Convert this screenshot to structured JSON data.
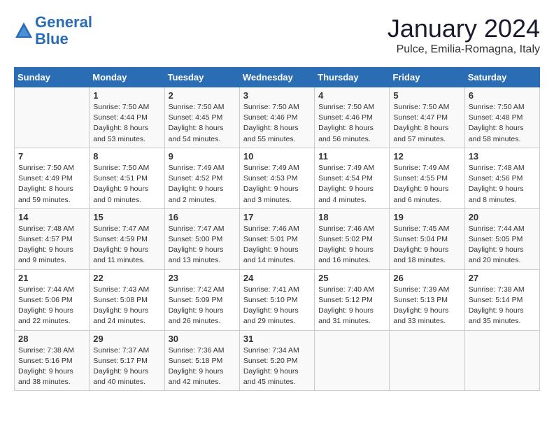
{
  "logo": {
    "line1": "General",
    "line2": "Blue"
  },
  "title": "January 2024",
  "location": "Pulce, Emilia-Romagna, Italy",
  "days_of_week": [
    "Sunday",
    "Monday",
    "Tuesday",
    "Wednesday",
    "Thursday",
    "Friday",
    "Saturday"
  ],
  "weeks": [
    [
      {
        "day": "",
        "info": ""
      },
      {
        "day": "1",
        "info": "Sunrise: 7:50 AM\nSunset: 4:44 PM\nDaylight: 8 hours\nand 53 minutes."
      },
      {
        "day": "2",
        "info": "Sunrise: 7:50 AM\nSunset: 4:45 PM\nDaylight: 8 hours\nand 54 minutes."
      },
      {
        "day": "3",
        "info": "Sunrise: 7:50 AM\nSunset: 4:46 PM\nDaylight: 8 hours\nand 55 minutes."
      },
      {
        "day": "4",
        "info": "Sunrise: 7:50 AM\nSunset: 4:46 PM\nDaylight: 8 hours\nand 56 minutes."
      },
      {
        "day": "5",
        "info": "Sunrise: 7:50 AM\nSunset: 4:47 PM\nDaylight: 8 hours\nand 57 minutes."
      },
      {
        "day": "6",
        "info": "Sunrise: 7:50 AM\nSunset: 4:48 PM\nDaylight: 8 hours\nand 58 minutes."
      }
    ],
    [
      {
        "day": "7",
        "info": "Sunrise: 7:50 AM\nSunset: 4:49 PM\nDaylight: 8 hours\nand 59 minutes."
      },
      {
        "day": "8",
        "info": "Sunrise: 7:50 AM\nSunset: 4:51 PM\nDaylight: 9 hours\nand 0 minutes."
      },
      {
        "day": "9",
        "info": "Sunrise: 7:49 AM\nSunset: 4:52 PM\nDaylight: 9 hours\nand 2 minutes."
      },
      {
        "day": "10",
        "info": "Sunrise: 7:49 AM\nSunset: 4:53 PM\nDaylight: 9 hours\nand 3 minutes."
      },
      {
        "day": "11",
        "info": "Sunrise: 7:49 AM\nSunset: 4:54 PM\nDaylight: 9 hours\nand 4 minutes."
      },
      {
        "day": "12",
        "info": "Sunrise: 7:49 AM\nSunset: 4:55 PM\nDaylight: 9 hours\nand 6 minutes."
      },
      {
        "day": "13",
        "info": "Sunrise: 7:48 AM\nSunset: 4:56 PM\nDaylight: 9 hours\nand 8 minutes."
      }
    ],
    [
      {
        "day": "14",
        "info": "Sunrise: 7:48 AM\nSunset: 4:57 PM\nDaylight: 9 hours\nand 9 minutes."
      },
      {
        "day": "15",
        "info": "Sunrise: 7:47 AM\nSunset: 4:59 PM\nDaylight: 9 hours\nand 11 minutes."
      },
      {
        "day": "16",
        "info": "Sunrise: 7:47 AM\nSunset: 5:00 PM\nDaylight: 9 hours\nand 13 minutes."
      },
      {
        "day": "17",
        "info": "Sunrise: 7:46 AM\nSunset: 5:01 PM\nDaylight: 9 hours\nand 14 minutes."
      },
      {
        "day": "18",
        "info": "Sunrise: 7:46 AM\nSunset: 5:02 PM\nDaylight: 9 hours\nand 16 minutes."
      },
      {
        "day": "19",
        "info": "Sunrise: 7:45 AM\nSunset: 5:04 PM\nDaylight: 9 hours\nand 18 minutes."
      },
      {
        "day": "20",
        "info": "Sunrise: 7:44 AM\nSunset: 5:05 PM\nDaylight: 9 hours\nand 20 minutes."
      }
    ],
    [
      {
        "day": "21",
        "info": "Sunrise: 7:44 AM\nSunset: 5:06 PM\nDaylight: 9 hours\nand 22 minutes."
      },
      {
        "day": "22",
        "info": "Sunrise: 7:43 AM\nSunset: 5:08 PM\nDaylight: 9 hours\nand 24 minutes."
      },
      {
        "day": "23",
        "info": "Sunrise: 7:42 AM\nSunset: 5:09 PM\nDaylight: 9 hours\nand 26 minutes."
      },
      {
        "day": "24",
        "info": "Sunrise: 7:41 AM\nSunset: 5:10 PM\nDaylight: 9 hours\nand 29 minutes."
      },
      {
        "day": "25",
        "info": "Sunrise: 7:40 AM\nSunset: 5:12 PM\nDaylight: 9 hours\nand 31 minutes."
      },
      {
        "day": "26",
        "info": "Sunrise: 7:39 AM\nSunset: 5:13 PM\nDaylight: 9 hours\nand 33 minutes."
      },
      {
        "day": "27",
        "info": "Sunrise: 7:38 AM\nSunset: 5:14 PM\nDaylight: 9 hours\nand 35 minutes."
      }
    ],
    [
      {
        "day": "28",
        "info": "Sunrise: 7:38 AM\nSunset: 5:16 PM\nDaylight: 9 hours\nand 38 minutes."
      },
      {
        "day": "29",
        "info": "Sunrise: 7:37 AM\nSunset: 5:17 PM\nDaylight: 9 hours\nand 40 minutes."
      },
      {
        "day": "30",
        "info": "Sunrise: 7:36 AM\nSunset: 5:18 PM\nDaylight: 9 hours\nand 42 minutes."
      },
      {
        "day": "31",
        "info": "Sunrise: 7:34 AM\nSunset: 5:20 PM\nDaylight: 9 hours\nand 45 minutes."
      },
      {
        "day": "",
        "info": ""
      },
      {
        "day": "",
        "info": ""
      },
      {
        "day": "",
        "info": ""
      }
    ]
  ]
}
